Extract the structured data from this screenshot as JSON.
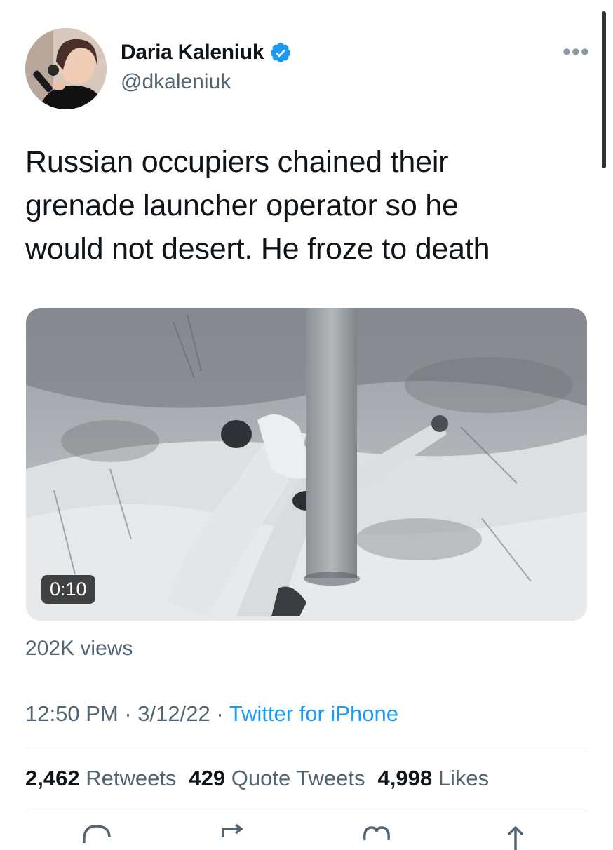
{
  "author": {
    "name": "Daria Kaleniuk",
    "handle": "@dkaleniuk",
    "verified_icon": "verified-badge-icon",
    "avatar_icon": "profile-photo"
  },
  "tweet": {
    "text_lines": [
      "Russian occupiers chained their",
      "grenade launcher operator so he",
      "would not desert. He froze to death"
    ],
    "video_duration": "0:10",
    "views": "202K views",
    "time": "12:50 PM",
    "date": "3/12/22",
    "separator": "·",
    "source": "Twitter for iPhone"
  },
  "stats": {
    "retweets_count": "2,462",
    "retweets_label": "Retweets",
    "quotes_count": "429",
    "quotes_label": "Quote Tweets",
    "likes_count": "4,998",
    "likes_label": "Likes"
  },
  "colors": {
    "link": "#1d9bf0",
    "secondary_text": "#536471",
    "primary_text": "#0f1419"
  },
  "more_icon": "more-options-icon"
}
